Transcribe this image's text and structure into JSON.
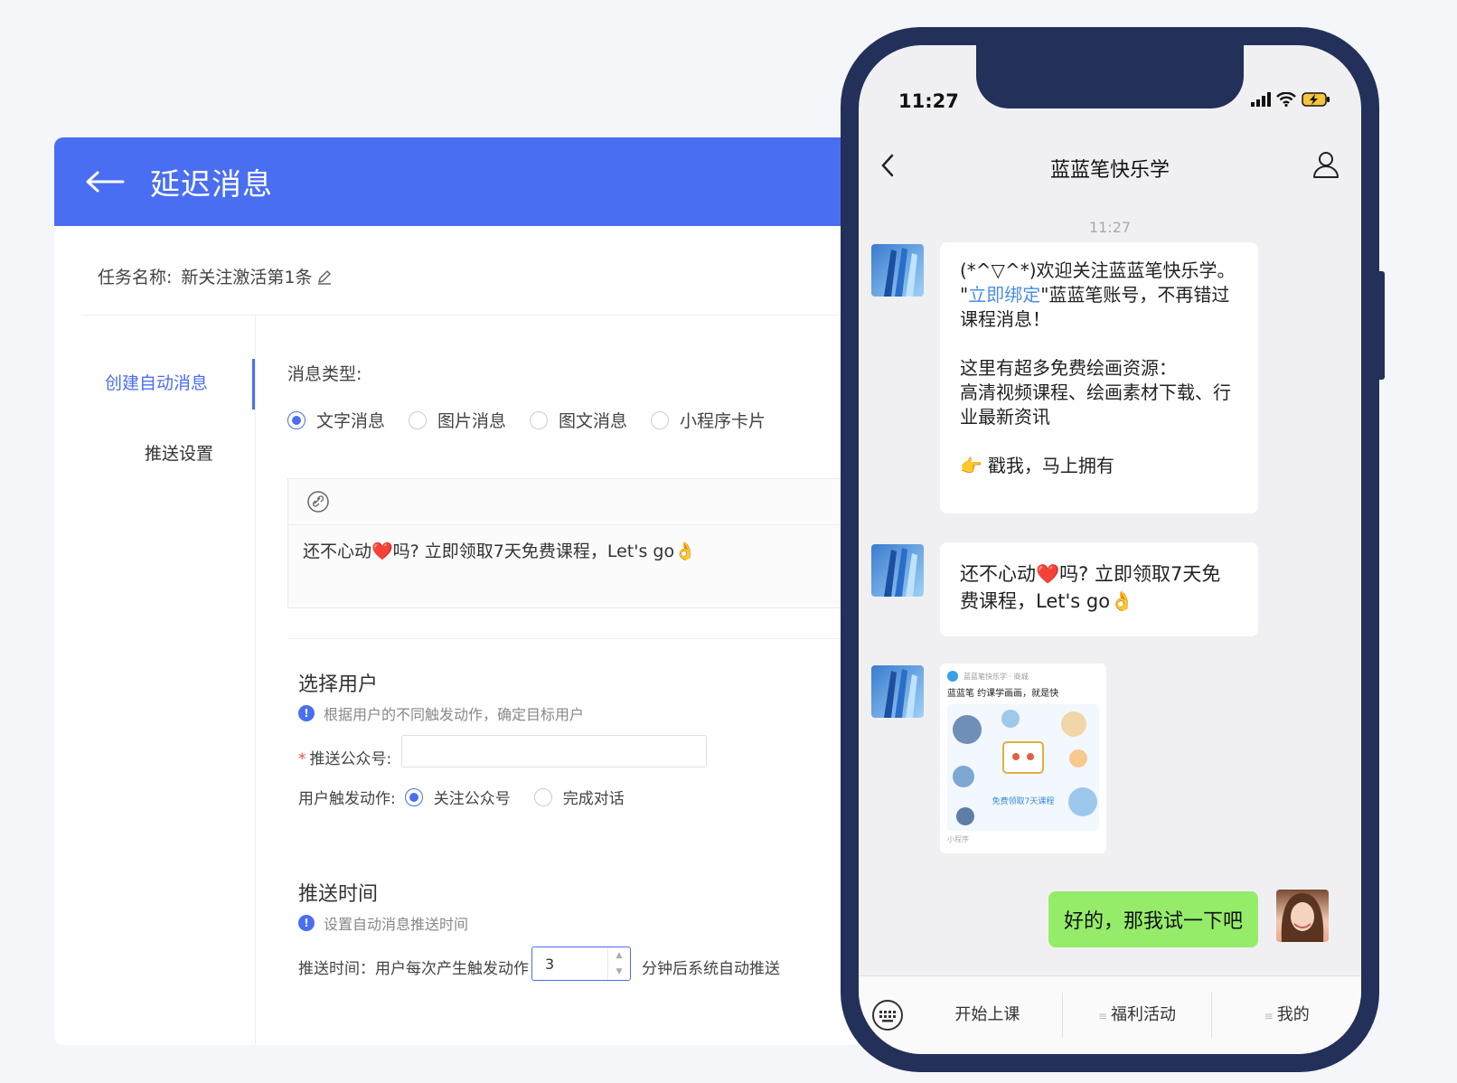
{
  "panel": {
    "title": "延迟消息",
    "task_label": "任务名称:",
    "task_name": "新关注激活第1条",
    "sidebar": [
      {
        "label": "创建自动消息",
        "active": true
      },
      {
        "label": "推送设置",
        "active": false
      }
    ],
    "message_type_label": "消息类型:",
    "message_types": [
      {
        "label": "文字消息",
        "selected": true
      },
      {
        "label": "图片消息",
        "selected": false
      },
      {
        "label": "图文消息",
        "selected": false
      },
      {
        "label": "小程序卡片",
        "selected": false
      }
    ],
    "editor_text": "还不心动❤️吗? 立即领取7天免费课程，Let's go👌",
    "select_users": {
      "title": "选择用户",
      "hint": "根据用户的不同触发动作，确定目标用户",
      "account_label": "推送公众号:",
      "account_value": "",
      "trigger_label": "用户触发动作:",
      "triggers": [
        {
          "label": "关注公众号",
          "selected": true
        },
        {
          "label": "完成对话",
          "selected": false
        }
      ]
    },
    "push_time": {
      "title": "推送时间",
      "hint": "设置自动消息推送时间",
      "label_before": "推送时间：用户每次产生触发动作",
      "minutes": "3",
      "label_after": "分钟后系统自动推送"
    }
  },
  "phone": {
    "status_time": "11:27",
    "chat_title": "蓝蓝笔快乐学",
    "timestamp": "11:27",
    "msg1": {
      "line1": "(*^▽^*)欢迎关注蓝蓝笔快乐学。",
      "quote_open": "\"",
      "link": "立即绑定",
      "after_link": "\"蓝蓝笔账号，不再错过课程消息！",
      "line3": "这里有超多免费绘画资源：",
      "line4": "高清视频课程、绘画素材下载、行业最新资讯",
      "cta": "戳我，马上拥有"
    },
    "msg2": "还不心动❤️吗? 立即领取7天免费课程，Let's go👌",
    "card": {
      "source": "蓝蓝笔快乐学 · 商城",
      "title": "蓝蓝笔 约课学画画，就是快",
      "tag": "免费领取7天课程",
      "footer": "小程序"
    },
    "reply": "好的，那我试一下吧",
    "menu": [
      "开始上课",
      "福利活动",
      "我的"
    ]
  }
}
